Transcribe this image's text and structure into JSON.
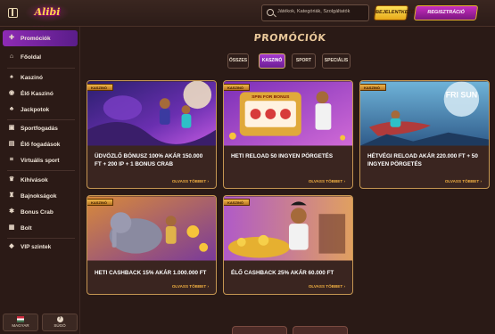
{
  "header": {
    "logo_text": "Alibi Kings",
    "search_placeholder": "Játékok, Kategóriák, Szolgáltatók",
    "login_label": "BEJELENTKEZÉS",
    "register_label": "REGISZTRÁCIÓ"
  },
  "sidebar": {
    "items": [
      {
        "label": "Promóciók",
        "icon": "gift-icon",
        "glyph": "✚"
      },
      {
        "label": "Főoldal",
        "icon": "home-icon",
        "glyph": "⌂"
      },
      {
        "label": "Kaszinó",
        "icon": "cards-icon",
        "glyph": "♠"
      },
      {
        "label": "Élő Kaszinó",
        "icon": "live-casino-icon",
        "glyph": "◉"
      },
      {
        "label": "Jackpotok",
        "icon": "clover-icon",
        "glyph": "♣"
      },
      {
        "label": "Sportfogadás",
        "icon": "sports-icon",
        "glyph": "▣"
      },
      {
        "label": "Élő fogadások",
        "icon": "live-bet-icon",
        "glyph": "▤"
      },
      {
        "label": "Virtuális sport",
        "icon": "virtual-sport-icon",
        "glyph": "⌗"
      },
      {
        "label": "Kihívások",
        "icon": "trophy-icon",
        "glyph": "♛"
      },
      {
        "label": "Bajnokságok",
        "icon": "tournament-icon",
        "glyph": "♜"
      },
      {
        "label": "Bonus Crab",
        "icon": "crab-icon",
        "glyph": "✱"
      },
      {
        "label": "Bolt",
        "icon": "shop-icon",
        "glyph": "▦"
      },
      {
        "label": "VIP szintek",
        "icon": "diamond-icon",
        "glyph": "◆"
      }
    ],
    "language_label": "MAGYAR",
    "help_label": "SÚGÓ"
  },
  "main": {
    "title": "PROMÓCIÓK",
    "filters": [
      "ÖSSZES",
      "KASZINÓ",
      "SPORT",
      "SPECIÁLIS"
    ],
    "active_filter": "KASZINÓ",
    "cards": [
      {
        "badge": "KASZINÓ",
        "title": "ÜDVÖZLŐ BÓNUSZ 100% AKÁR 150.000 FT + 200 IP + 1 BONUS CRAB",
        "more": "OLVASS TÖBBET"
      },
      {
        "badge": "KASZINÓ",
        "title": "HETI RELOAD 50 INGYEN PÖRGETÉS",
        "more": "OLVASS TÖBBET"
      },
      {
        "badge": "KASZINÓ",
        "title": "HÉTVÉGI RELOAD AKÁR 220.000 FT + 50 INGYEN PÖRGETÉS",
        "more": "OLVASS TÖBBET"
      },
      {
        "badge": "KASZINÓ",
        "title": "HETI CASHBACK 15% AKÁR 1.000.000 FT",
        "more": "OLVASS TÖBBET"
      },
      {
        "badge": "KASZINÓ",
        "title": "ÉLŐ CASHBACK 25% AKÁR 60.000 FT",
        "more": "OLVASS TÖBBET"
      }
    ],
    "card3_image_text": "FRI SUN",
    "card2_image_text": "SPIN FOR BONUS"
  },
  "colors": {
    "accent_purple": "#8e2bb4",
    "gold": "#e7a91a",
    "background": "#2a1a16"
  }
}
